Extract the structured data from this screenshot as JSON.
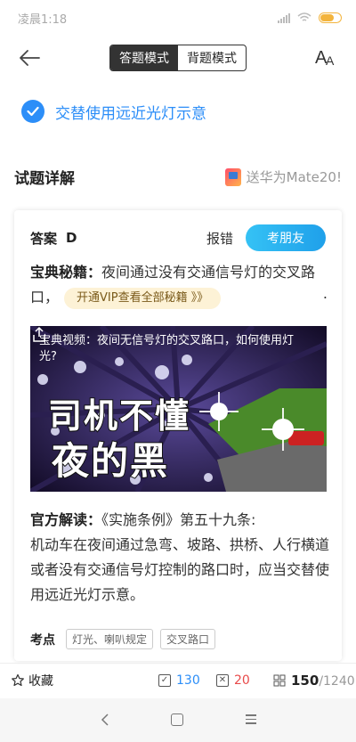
{
  "status": {
    "time": "凌晨1:18"
  },
  "header": {
    "tabs": [
      {
        "label": "答题模式",
        "active": true
      },
      {
        "label": "背题模式",
        "active": false
      }
    ]
  },
  "selected_option": {
    "text": "交替使用远近光灯示意"
  },
  "section": {
    "title": "试题详解",
    "promo": "送华为Mate20!"
  },
  "card": {
    "answer_label": "答案",
    "answer_value": "D",
    "report_label": "报错",
    "share_label": "考朋友",
    "tips_label": "宝典秘籍：",
    "tips_text": "夜间通过没有交通信号灯的交叉路口，",
    "vip_label": "开通VIP查看全部秘籍 》》",
    "tips_end": ".",
    "video": {
      "title": "宝典视频：夜间无信号灯的交叉路口，如何使用灯光?",
      "big_line1": "司机不懂",
      "big_line2": "夜的黑"
    },
    "explain_label": "官方解读：",
    "explain_text": "《实施条例》第五十九条:",
    "explain_body": "机动车在夜间通过急弯、坡路、拱桥、人行横道或者没有交通信号灯控制的路口时，应当交替使用远近光灯示意。",
    "kaodian_label": "考点",
    "tags": [
      "灯光、喇叭规定",
      "交叉路口"
    ]
  },
  "bottom": {
    "fav_label": "收藏",
    "right_count": "130",
    "wrong_count": "20",
    "current": "150",
    "total": "/1240"
  },
  "colors": {
    "accent": "#2c8ef8",
    "wrong": "#e84a4a",
    "share_btn": "#1fa0ea",
    "vip_bg": "#fdf2d6"
  }
}
